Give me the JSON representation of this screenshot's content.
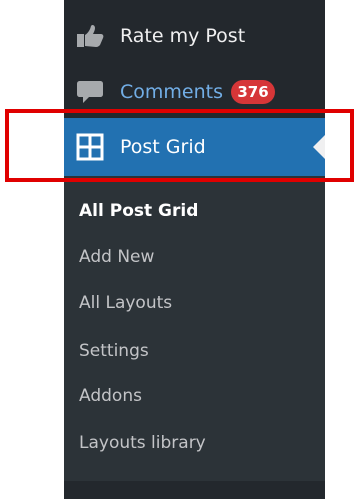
{
  "menu": {
    "rate_my_post": {
      "label": "Rate my Post",
      "icon": "thumbs-up-icon"
    },
    "comments": {
      "label": "Comments",
      "count": "376",
      "icon": "speech-bubble-icon",
      "label_color": "#72aee6"
    },
    "post_grid": {
      "label": "Post Grid",
      "icon": "grid-icon",
      "active_color": "#2271b1"
    }
  },
  "submenu": {
    "items": [
      {
        "label": "All Post Grid",
        "current": true
      },
      {
        "label": "Add New"
      },
      {
        "label": "All Layouts"
      },
      {
        "label": "Settings"
      },
      {
        "label": "Addons"
      },
      {
        "label": "Layouts library"
      }
    ]
  },
  "colors": {
    "sidebar_background": "#23282d",
    "submenu_background": "#2c3338",
    "badge_background": "#d63638",
    "highlight_outline": "#e00000"
  }
}
